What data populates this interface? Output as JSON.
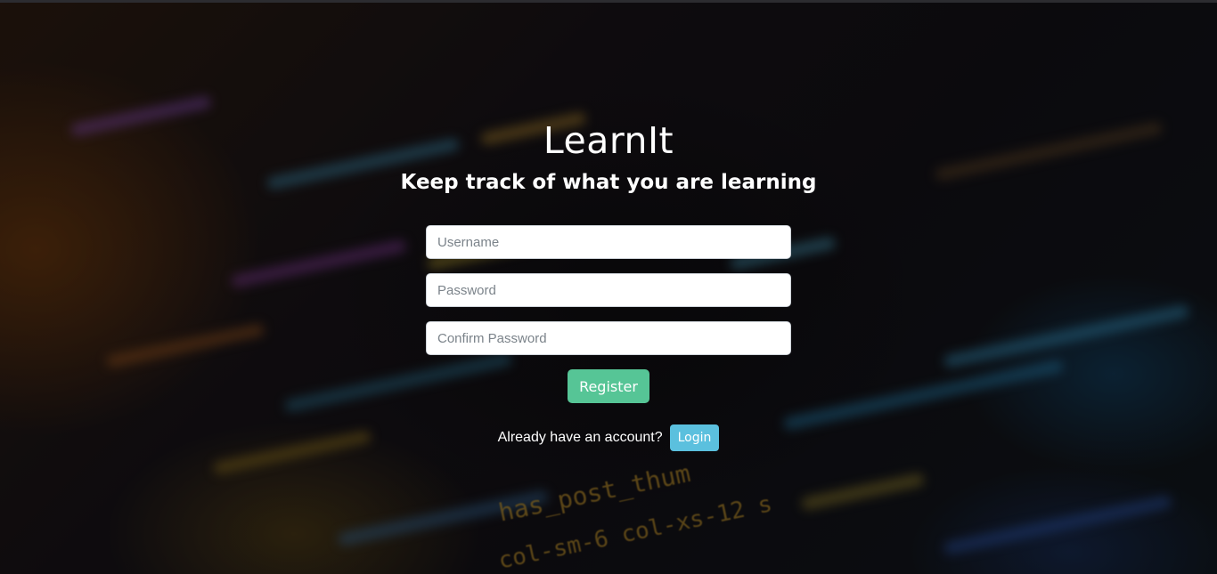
{
  "app": {
    "title": "LearnIt",
    "subtitle": "Keep track of what you are learning"
  },
  "form": {
    "username_placeholder": "Username",
    "password_placeholder": "Password",
    "confirm_password_placeholder": "Confirm Password",
    "register_label": "Register"
  },
  "login": {
    "prompt": "Already have an account?",
    "button_label": "Login"
  },
  "background_code": {
    "line1": "has_post_thum",
    "line2": "col-sm-6 col-xs-12 s"
  },
  "colors": {
    "register_button": "#56c596",
    "login_button": "#5bc0de",
    "text": "#ffffff"
  }
}
